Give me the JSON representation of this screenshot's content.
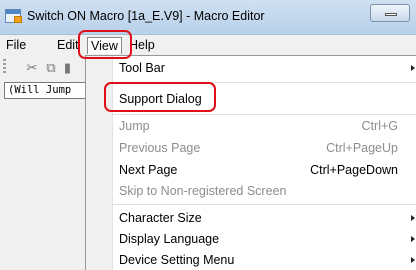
{
  "window": {
    "title": "Switch ON Macro [1a_E.V9] - Macro Editor"
  },
  "menubar": {
    "items": [
      {
        "label": "File"
      },
      {
        "label": "Edit"
      },
      {
        "label": "View"
      },
      {
        "label": "Help"
      }
    ],
    "active": "View"
  },
  "toolbar": {
    "icons": [
      "cut-icon",
      "copy-icon",
      "paste-icon"
    ]
  },
  "editor": {
    "command_text": "(Will Jump"
  },
  "view_menu": {
    "items": [
      {
        "label": "Tool Bar",
        "submenu": true,
        "enabled": true
      },
      {
        "label": "Support Dialog",
        "enabled": true,
        "highlighted": true
      },
      {
        "label": "Jump",
        "shortcut": "Ctrl+G",
        "enabled": false
      },
      {
        "label": "Previous Page",
        "shortcut": "Ctrl+PageUp",
        "enabled": false
      },
      {
        "label": "Next Page",
        "shortcut": "Ctrl+PageDown",
        "enabled": true
      },
      {
        "label": "Skip to Non-registered Screen",
        "enabled": false
      },
      {
        "label": "Character Size",
        "submenu": true,
        "enabled": true
      },
      {
        "label": "Display Language",
        "submenu": true,
        "enabled": true
      },
      {
        "label": "Device Setting Menu",
        "submenu": true,
        "enabled": true
      }
    ]
  },
  "colors": {
    "highlight_outline": "#e0101a",
    "disabled_text": "#8d8d8d"
  }
}
